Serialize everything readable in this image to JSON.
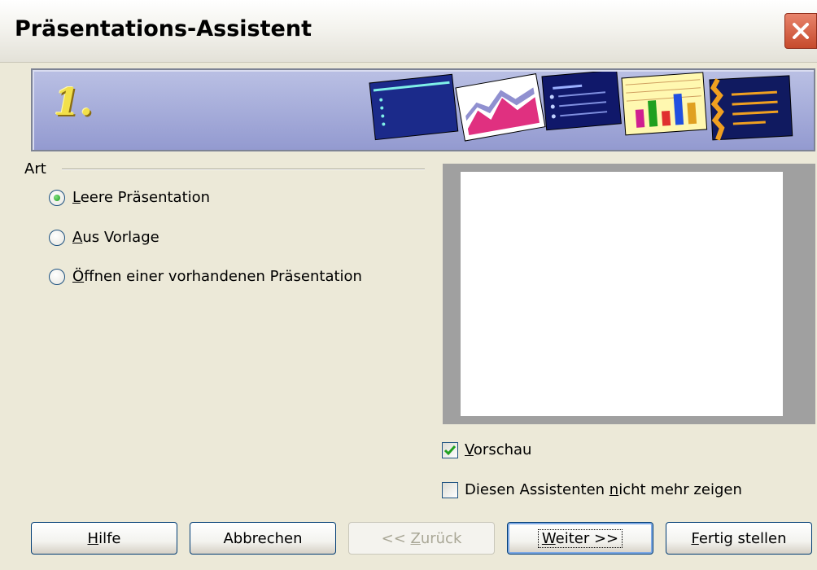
{
  "window": {
    "title": "Präsentations-Assistent",
    "close_icon": "close-x-icon"
  },
  "banner": {
    "step": "1."
  },
  "art_group": {
    "label": "Art",
    "options": [
      {
        "pre": "",
        "key": "L",
        "post": "eere Präsentation",
        "selected": true
      },
      {
        "pre": "",
        "key": "A",
        "post": "us Vorlage",
        "selected": false
      },
      {
        "pre": "",
        "key": "Ö",
        "post": "ffnen einer vorhandenen Präsentation",
        "selected": false
      }
    ]
  },
  "checks": {
    "preview": {
      "pre": "",
      "key": "V",
      "post": "orschau",
      "checked": true
    },
    "dont_show": {
      "pre": "Diesen Assistenten ",
      "key": "n",
      "post": "icht mehr zeigen",
      "checked": false
    }
  },
  "buttons": {
    "help": {
      "pre": "",
      "key": "H",
      "post": "ilfe"
    },
    "cancel": {
      "label": "Abbrechen"
    },
    "back": {
      "pre": "<< ",
      "key": "Z",
      "post": "urück"
    },
    "next": {
      "pre": "",
      "key": "W",
      "post": "eiter >>"
    },
    "finish": {
      "pre": "",
      "key": "F",
      "post": "ertig stellen"
    }
  },
  "colors": {
    "dialog_bg": "#ece9d8",
    "banner_bg": "#939ad0",
    "step_yellow": "#f2e04a",
    "radio_green": "#1f9c1f",
    "close_red": "#c64a2c"
  }
}
